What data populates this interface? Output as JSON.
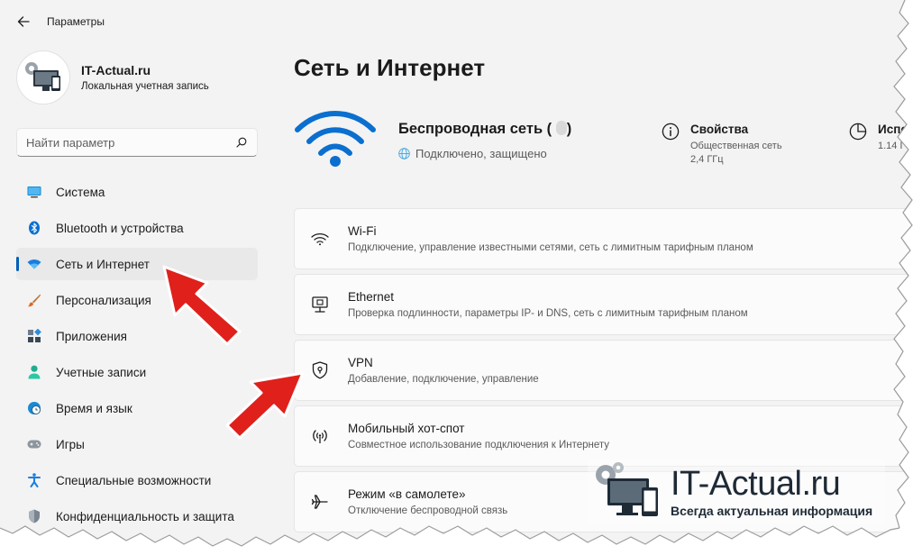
{
  "window": {
    "title": "Параметры"
  },
  "profile": {
    "name": "IT-Actual.ru",
    "account_type": "Локальная учетная запись"
  },
  "search": {
    "placeholder": "Найти параметр"
  },
  "sidebar": {
    "items": [
      {
        "label": "Система",
        "icon": "monitor-icon"
      },
      {
        "label": "Bluetooth и устройства",
        "icon": "bluetooth-icon"
      },
      {
        "label": "Сеть и Интернет",
        "icon": "network-icon",
        "active": true
      },
      {
        "label": "Персонализация",
        "icon": "brush-icon"
      },
      {
        "label": "Приложения",
        "icon": "apps-icon"
      },
      {
        "label": "Учетные записи",
        "icon": "person-icon"
      },
      {
        "label": "Время и язык",
        "icon": "clock-globe-icon"
      },
      {
        "label": "Игры",
        "icon": "gamepad-icon"
      },
      {
        "label": "Специальные возможности",
        "icon": "accessibility-icon"
      },
      {
        "label": "Конфиденциальность и защита",
        "icon": "shield-icon"
      }
    ]
  },
  "main": {
    "title": "Сеть и Интернет",
    "network": {
      "name": "Беспроводная сеть (",
      "status": "Подключено, защищено"
    },
    "properties": {
      "title": "Свойства",
      "line1": "Общественная сеть",
      "line2": "2,4 ГГц"
    },
    "usage": {
      "title": "Испо",
      "line1": "1.14 Г"
    },
    "cards": [
      {
        "title": "Wi-Fi",
        "description": "Подключение, управление известными сетями, сеть с лимитным тарифным планом",
        "icon": "wifi-icon"
      },
      {
        "title": "Ethernet",
        "description": "Проверка подлинности, параметры IP- и DNS, сеть с лимитным тарифным планом",
        "icon": "ethernet-icon"
      },
      {
        "title": "VPN",
        "description": "Добавление, подключение, управление",
        "icon": "vpn-shield-icon"
      },
      {
        "title": "Мобильный хот-спот",
        "description": "Совместное использование подключения к Интернету",
        "icon": "hotspot-icon"
      },
      {
        "title": "Режим «в самолете»",
        "description": "Отключение беспроводной связь",
        "icon": "airplane-icon"
      }
    ]
  },
  "watermark": {
    "title": "IT-Actual.ru",
    "subtitle": "Всегда актуальная информация"
  },
  "colors": {
    "accent": "#005fb8",
    "arrow": "#e0201b",
    "background": "#f3f3f3",
    "card": "#fbfbfb"
  }
}
